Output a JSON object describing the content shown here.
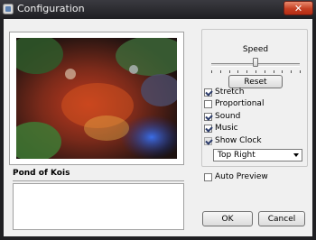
{
  "window": {
    "title": "Configuration",
    "close_label": "✕"
  },
  "preview": {
    "caption": "Pond of Kois"
  },
  "speed": {
    "label": "Speed",
    "value_fraction": 0.5
  },
  "buttons": {
    "reset": "Reset",
    "ok": "OK",
    "cancel": "Cancel"
  },
  "options": {
    "stretch": {
      "label": "Stretch",
      "checked": true
    },
    "proportional": {
      "label": "Proportional",
      "checked": false
    },
    "sound": {
      "label": "Sound",
      "checked": true
    },
    "music": {
      "label": "Music",
      "checked": true
    },
    "show_clock": {
      "label": "Show Clock",
      "checked": true,
      "disabled": true
    },
    "auto_preview": {
      "label": "Auto Preview",
      "checked": false
    }
  },
  "clock_position": {
    "selected": "Top Right"
  },
  "colors": {
    "titlebar": "#202024",
    "close": "#c53f23",
    "client": "#f0f0f0"
  }
}
